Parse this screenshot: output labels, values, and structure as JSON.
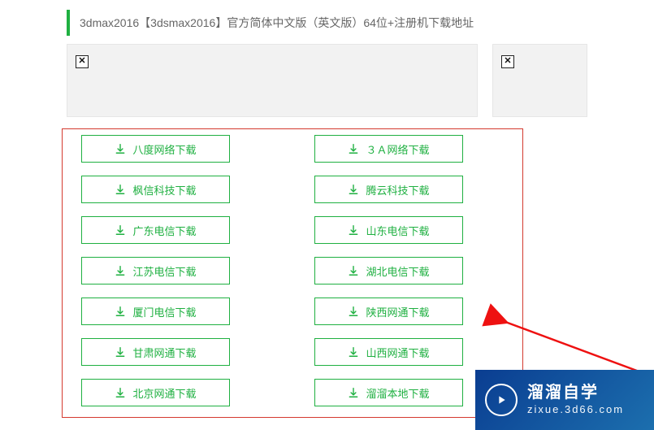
{
  "header": {
    "title": "3dmax2016【3dsmax2016】官方简体中文版（英文版）64位+注册机下载地址"
  },
  "downloads": {
    "left": [
      "八度网络下载",
      "枫信科技下载",
      "广东电信下载",
      "江苏电信下载",
      "厦门电信下载",
      "甘肃网通下载",
      "北京网通下载"
    ],
    "right": [
      "３Ａ网络下载",
      "腾云科技下载",
      "山东电信下载",
      "湖北电信下载",
      "陕西网通下载",
      "山西网通下载",
      "溜溜本地下载"
    ]
  },
  "watermark": {
    "title": "溜溜自学",
    "url": "zixue.3d66.com"
  }
}
